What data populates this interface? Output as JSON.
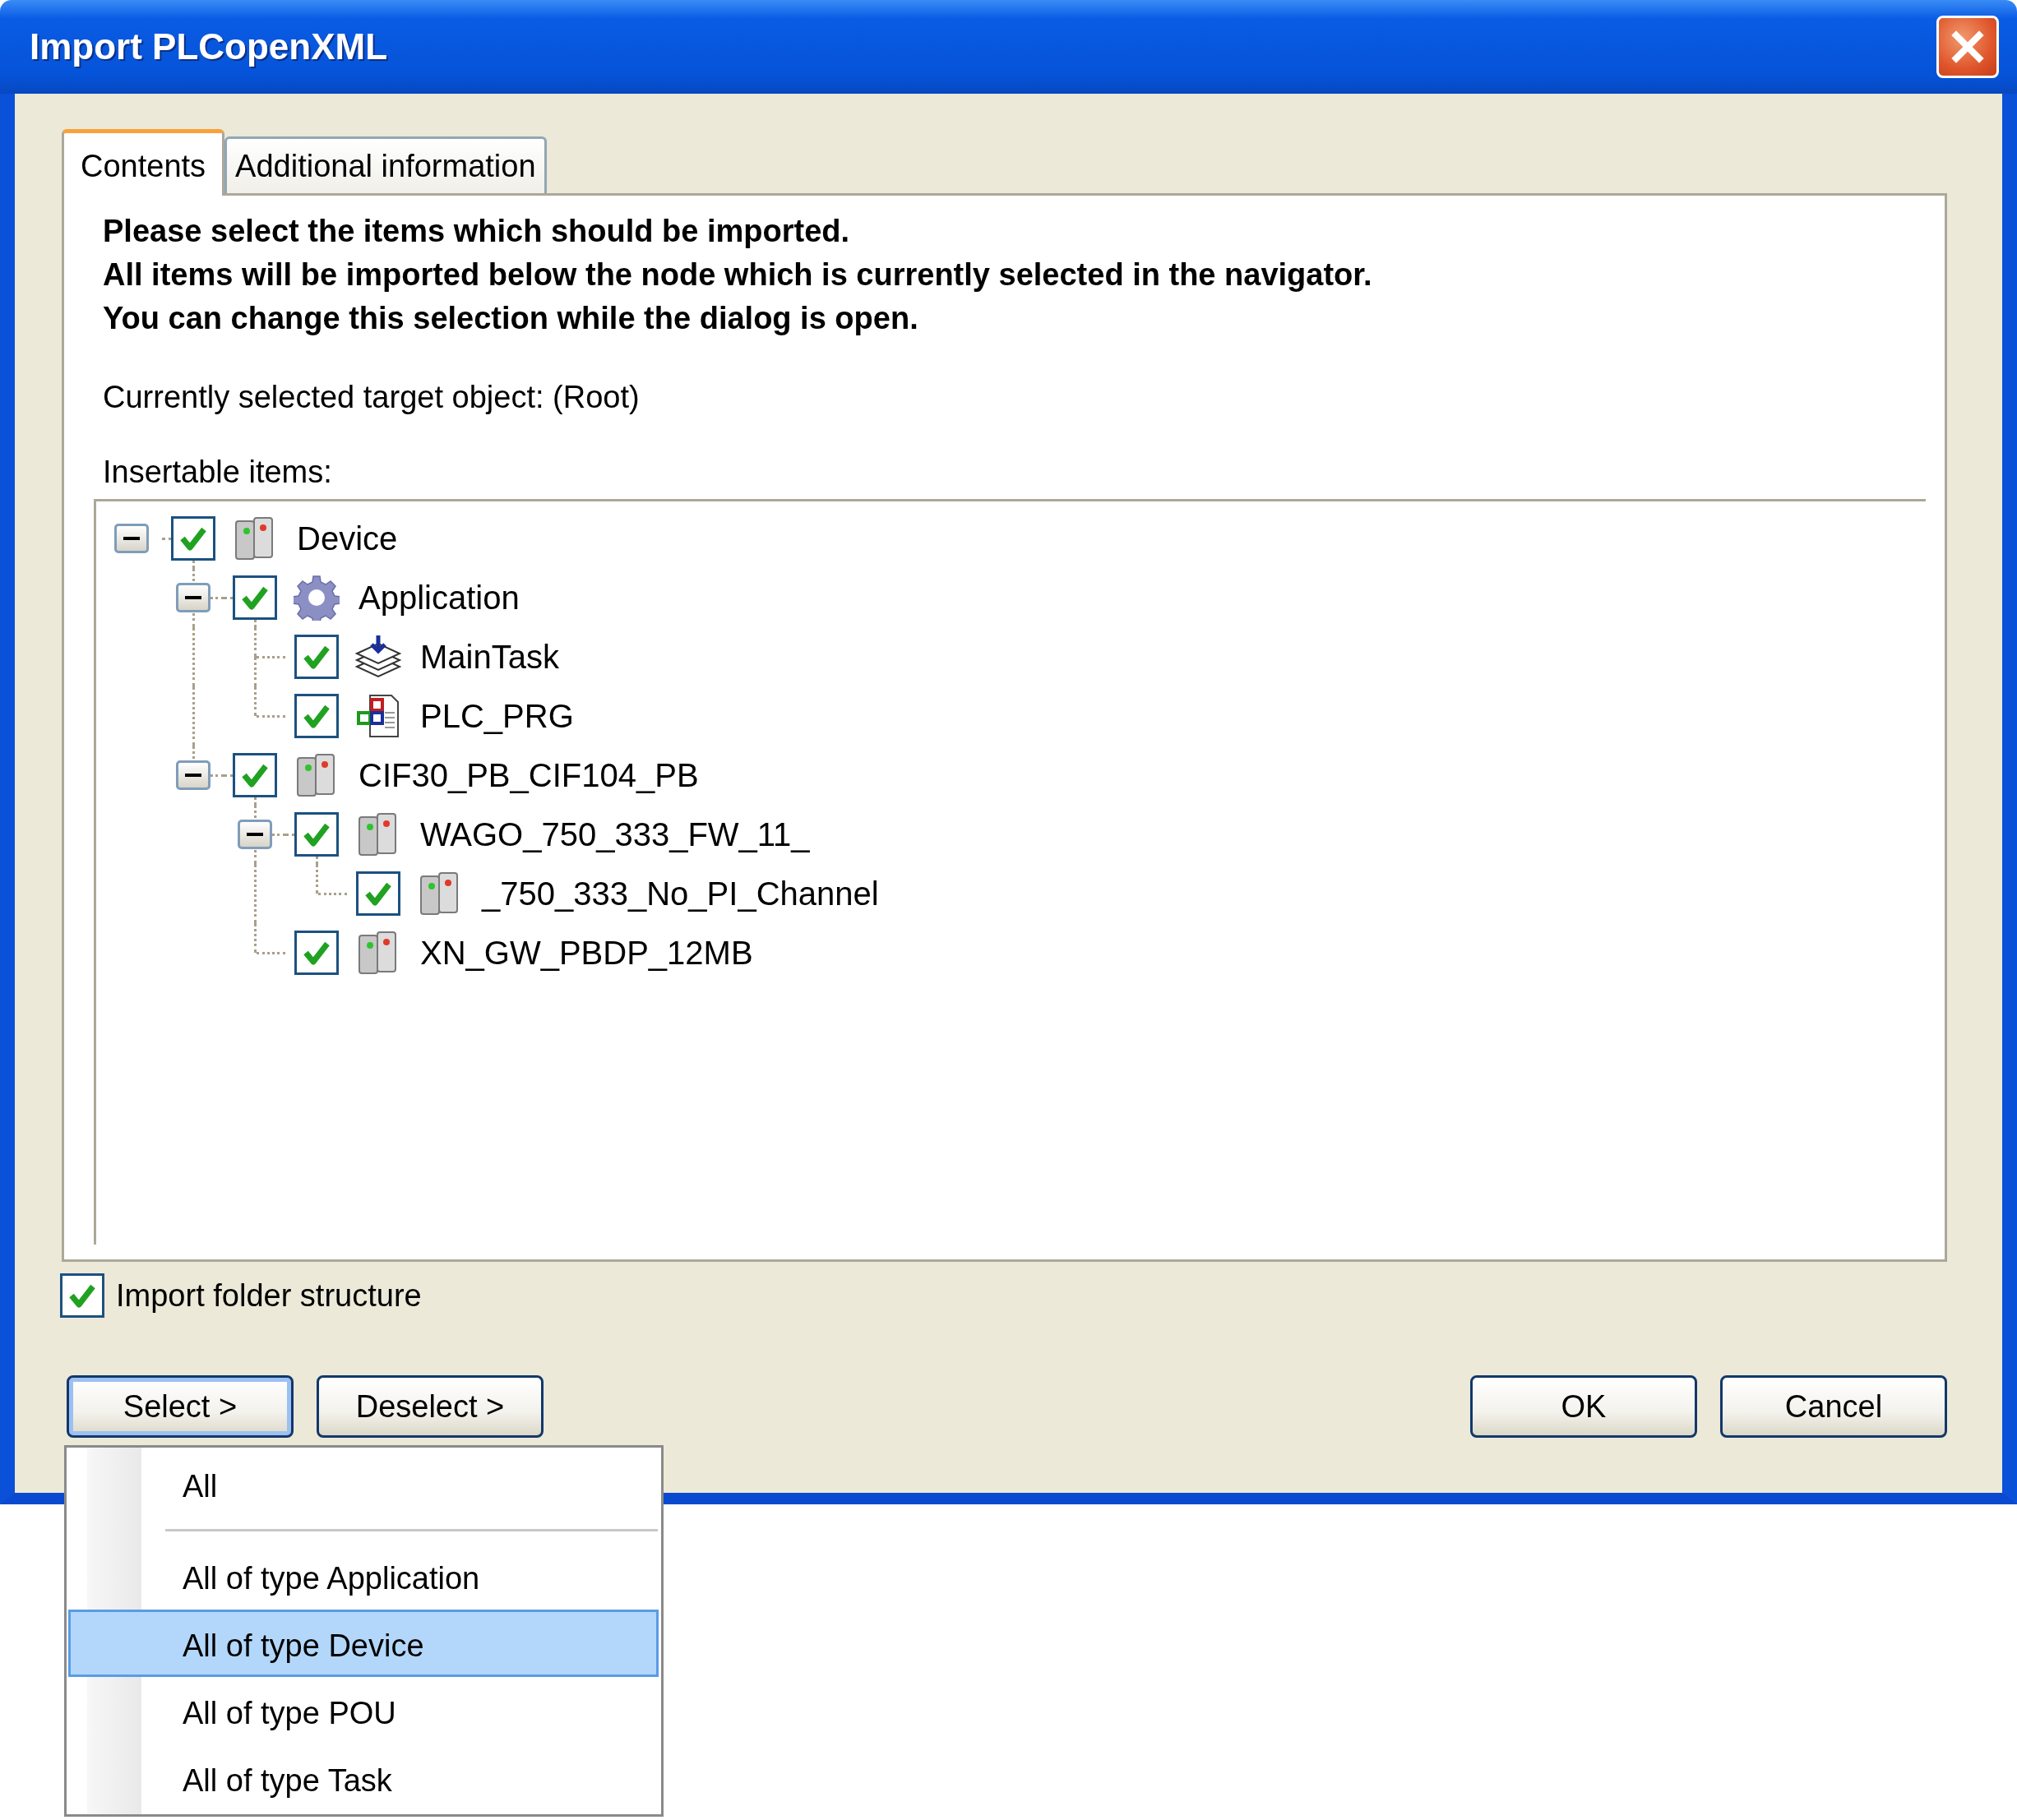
{
  "window": {
    "title": "Import PLCopenXML"
  },
  "tabs": [
    {
      "label": "Contents",
      "selected": true
    },
    {
      "label": "Additional information",
      "selected": false
    }
  ],
  "instructions": [
    "Please select the items which should be imported.",
    "All items will be imported below the node which is currently selected in the navigator.",
    "You can change this selection while the dialog is open."
  ],
  "target_label": "Currently selected target object: (Root)",
  "tree_label": "Insertable items:",
  "tree": [
    {
      "label": "Device",
      "kind": "device",
      "checked": true,
      "expanded": true,
      "children": [
        {
          "label": "Application",
          "kind": "application",
          "checked": true,
          "expanded": true,
          "children": [
            {
              "label": "MainTask",
              "kind": "task",
              "checked": true
            },
            {
              "label": "PLC_PRG",
              "kind": "pou",
              "checked": true
            }
          ]
        },
        {
          "label": "CIF30_PB_CIF104_PB",
          "kind": "device",
          "checked": true,
          "expanded": true,
          "children": [
            {
              "label": "WAGO_750_333_FW_11_",
              "kind": "device",
              "checked": true,
              "expanded": true,
              "children": [
                {
                  "label": "_750_333_No_PI_Channel",
                  "kind": "device",
                  "checked": true
                }
              ]
            },
            {
              "label": "XN_GW_PBDP_12MB",
              "kind": "device",
              "checked": true
            }
          ]
        }
      ]
    }
  ],
  "import_folder_structure": {
    "label": "Import folder structure",
    "checked": true
  },
  "selection_buttons": [
    {
      "label": "Select >",
      "focused": true
    },
    {
      "label": "Deselect >",
      "focused": false
    }
  ],
  "dialog_buttons": [
    {
      "label": "OK",
      "focused": false
    },
    {
      "label": "Cancel",
      "focused": false
    }
  ],
  "menu": {
    "items": [
      {
        "kind": "item",
        "label": "All",
        "selected": false
      },
      {
        "kind": "separator"
      },
      {
        "kind": "item",
        "label": "All of type Application",
        "selected": false
      },
      {
        "kind": "item",
        "label": "All of type Device",
        "selected": true
      },
      {
        "kind": "item",
        "label": "All of type POU",
        "selected": false
      },
      {
        "kind": "item",
        "label": "All of type Task",
        "selected": false
      }
    ]
  }
}
